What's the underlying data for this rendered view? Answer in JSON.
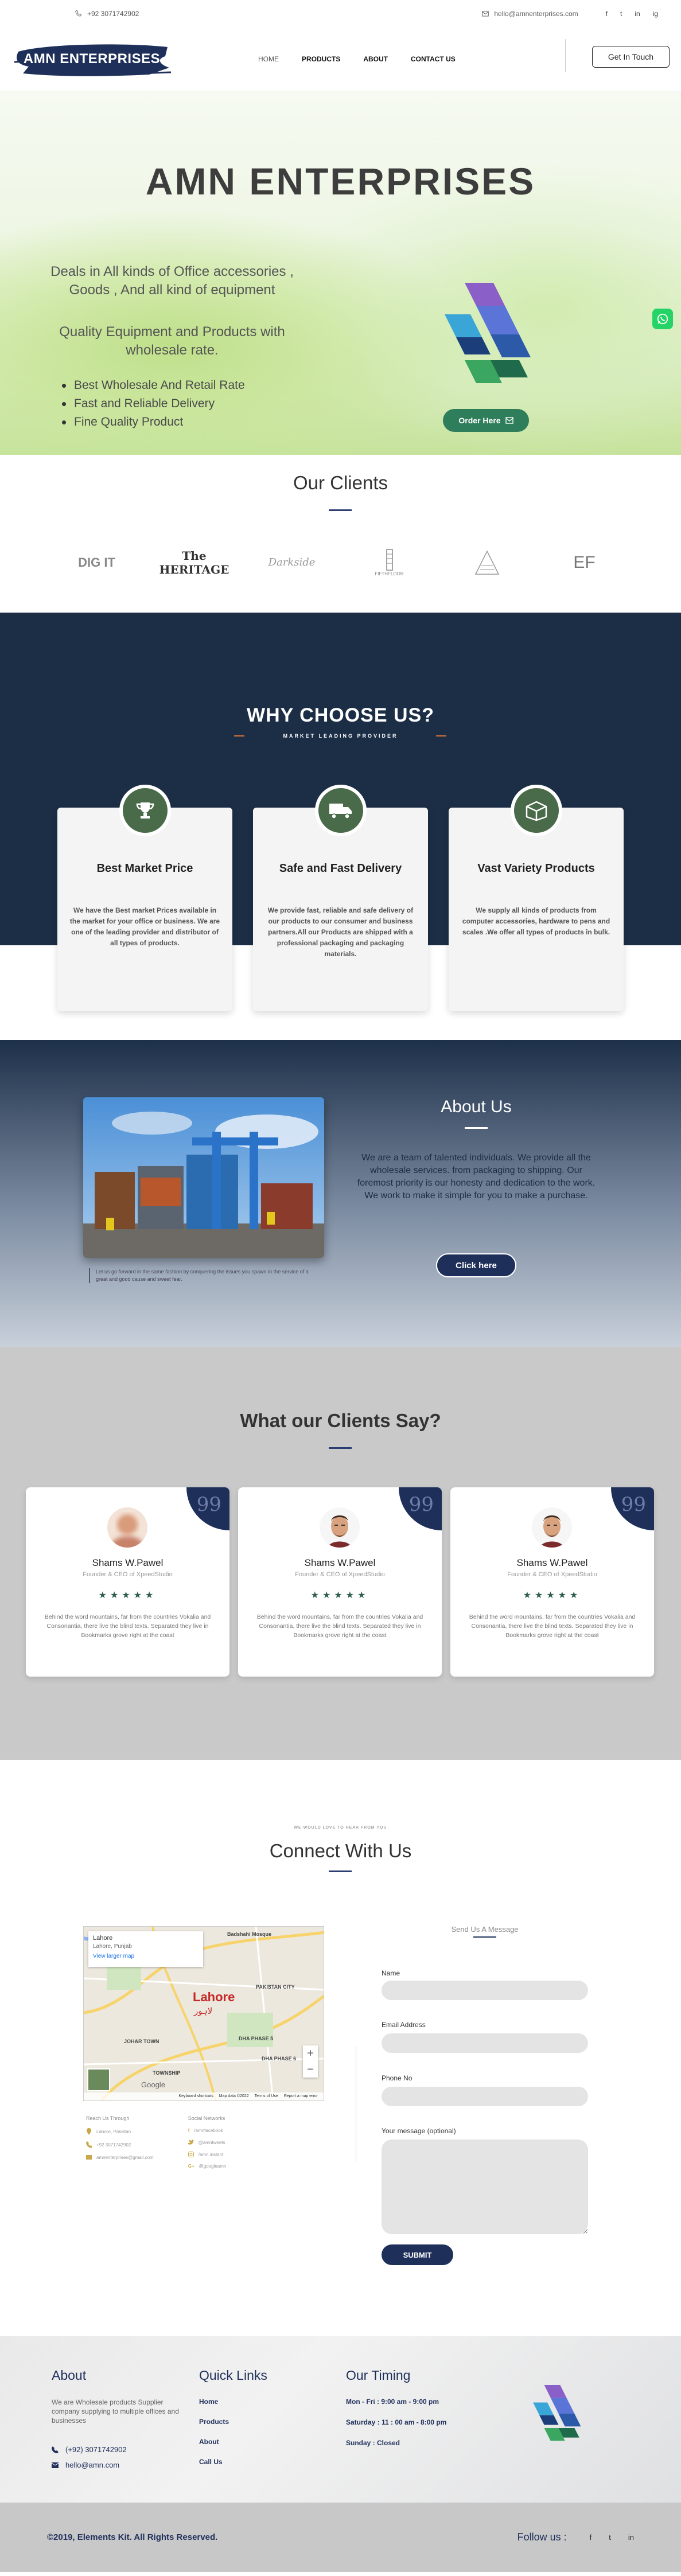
{
  "topbar": {
    "phone": "+92 3071742902",
    "email": "hello@amnenterprises.com",
    "socials": [
      "f",
      "t",
      "in",
      "ig"
    ]
  },
  "header": {
    "logo_text": "AMN ENTERPRISES",
    "nav": [
      "HOME",
      "PRODUCTS",
      "ABOUT",
      "CONTACT US"
    ],
    "cta": "Get In Touch"
  },
  "hero": {
    "title": "AMN ENTERPRISES",
    "lead": "Deals in All kinds of Office accessories , Goods , And all kind of equipment",
    "sub": "Quality Equipment and Products with wholesale rate.",
    "bullets": [
      "Best Wholesale And Retail Rate",
      "Fast and Reliable Delivery",
      "Fine Quality Product"
    ],
    "cta": "Order Here"
  },
  "clients": {
    "title": "Our Clients",
    "logos": [
      "DIG IT",
      "The HERITAGE",
      "Darkside",
      "FIFTHFLOOR",
      "Tower",
      "EF"
    ]
  },
  "why": {
    "title": "WHY CHOOSE US?",
    "subtitle": "MARKET LEADING PROVIDER",
    "cards": [
      {
        "title": "Best Market Price",
        "text": "We have the Best market Prices available in the market for your office or business.  We are one of the leading provider and distributor of all types of products."
      },
      {
        "title": "Safe and Fast Delivery",
        "text": "We provide fast, reliable and safe delivery of our products to our consumer and business partners.All our Products are shipped with a professional packaging and packaging materials."
      },
      {
        "title": "Vast Variety Products",
        "text": "We supply all kinds of products from computer accessories, hardware to pens and scales .We offer all types of products in bulk."
      }
    ]
  },
  "about": {
    "title": "About Us",
    "text": "We are a team of talented individuals. We provide all the wholesale services. from packaging to shipping. Our foremost priority is our honesty and dedication to the work. We work to make it simple for you to make a purchase.",
    "caption": "Let us go forward in the same fashion by conquering the issues you spawn in the service of a great and good cause and sweet fear.",
    "cta": "Click here"
  },
  "testimonials": {
    "title": "What our Clients Say?",
    "items": [
      {
        "name": "Shams W.Pawel",
        "role": "Founder & CEO of XpeedStudio",
        "stars": "★★★★★",
        "text": "Behind the word mountains, far from the countries Vokalia and Consonantia, there live the blind texts. Separated they live in Bookmarks grove right at the coast"
      },
      {
        "name": "Shams W.Pawel",
        "role": "Founder & CEO of XpeedStudio",
        "stars": "★★★★★",
        "text": "Behind the word mountains, far from the countries Vokalia and Consonantia, there live the blind texts. Separated they live in Bookmarks grove right at the coast"
      },
      {
        "name": "Shams W.Pawel",
        "role": "Founder & CEO of XpeedStudio",
        "stars": "★★★★★",
        "text": "Behind the word mountains, far from the countries Vokalia and Consonantia, there live the blind texts. Separated they live in Bookmarks grove right at the coast"
      }
    ]
  },
  "connect": {
    "pre": "WE WOULD LOVE TO HEAR FROM YOU",
    "title": "Connect With Us",
    "map": {
      "place": "Lahore",
      "region": "Lahore, Punjab",
      "link": "View larger map",
      "city": "Lahore",
      "city_local": "لاہور",
      "labels": [
        "Badshahi Mosque",
        "PAKISTAN CITY",
        "JOHAR TOWN",
        "DHA PHASE 5",
        "DHA PHASE 6",
        "TOWNSHIP"
      ],
      "google": "Google",
      "footer": [
        "Keyboard shortcuts",
        "Map data ©2022",
        "Terms of Use",
        "Report a map error"
      ]
    },
    "left_col": {
      "heading": "Reach Us Through",
      "items": [
        "Lahore, Pakistan",
        "+92 3071742902",
        "amnenterprises@gmail.com"
      ]
    },
    "right_col": {
      "heading": "Social Networks",
      "items": [
        "/amnfacebook",
        "@amntweets",
        "/amn.instant",
        "@googleamn"
      ]
    },
    "form": {
      "title": "Send Us A Message",
      "labels": [
        "Name",
        "Email Address",
        "Phone No",
        "Your message (optional)"
      ],
      "submit": "SUBMIT"
    }
  },
  "footer": {
    "about_title": "About",
    "about_text": "We are Wholesale products Supplier company supplying to multiple offices and businesses",
    "phone": "(+92) 3071742902",
    "email": "hello@amn.com",
    "links_title": "Quick Links",
    "links": [
      "Home",
      "Products",
      "About",
      "Call Us"
    ],
    "timing_title": "Our Timing",
    "timing": [
      "Mon - Fri : 9:00 am - 9:00 pm",
      "Saturday : 11 : 00 am - 8:00 pm",
      "Sunday : Closed"
    ],
    "copyright": "©2019, Elements Kit. All Rights Reserved.",
    "follow": "Follow us :",
    "socials": [
      "f",
      "t",
      "in"
    ]
  },
  "colors": {
    "navy": "#1e2f5a",
    "dark_navy": "#1b2e46",
    "green": "#2e7d5b"
  }
}
